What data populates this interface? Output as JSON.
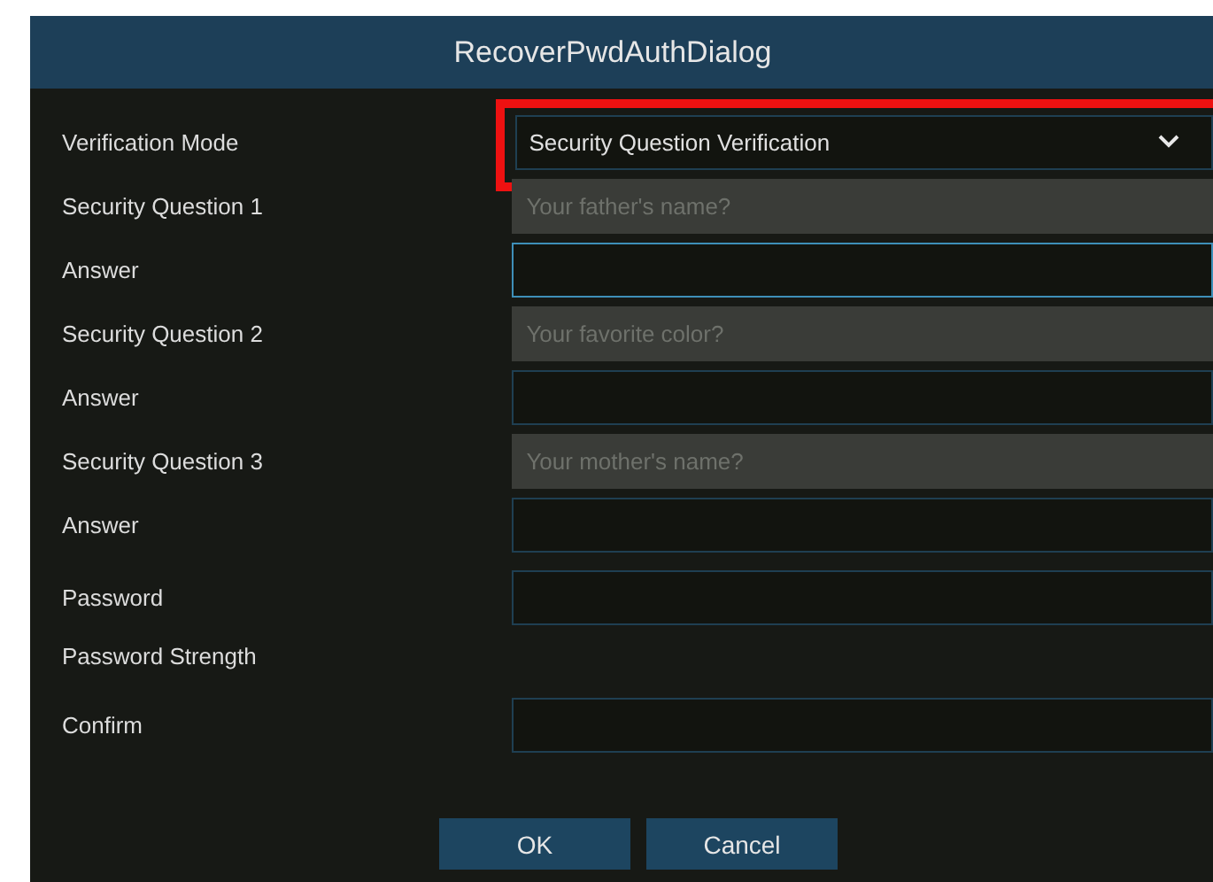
{
  "dialog": {
    "title": "RecoverPwdAuthDialog"
  },
  "rows": [
    {
      "kind": "select",
      "label": "Verification Mode",
      "value": "Security Question Verification",
      "highlighted": true
    },
    {
      "kind": "question",
      "label": "Security Question 1",
      "value": "Your father's name?",
      "disabled": true
    },
    {
      "kind": "input",
      "label": "Answer",
      "focused": true
    },
    {
      "kind": "question",
      "label": "Security Question 2",
      "value": "Your favorite color?",
      "disabled": true
    },
    {
      "kind": "input",
      "label": "Answer",
      "focused": false
    },
    {
      "kind": "question",
      "label": "Security Question 3",
      "value": "Your mother's name?",
      "disabled": true
    },
    {
      "kind": "input",
      "label": "Answer",
      "focused": false
    },
    {
      "kind": "password",
      "label": "Password",
      "focused": false
    },
    {
      "kind": "text",
      "label": "Password Strength"
    },
    {
      "kind": "password",
      "label": "Confirm",
      "focused": false
    }
  ],
  "buttons": [
    "OK",
    "Cancel"
  ]
}
